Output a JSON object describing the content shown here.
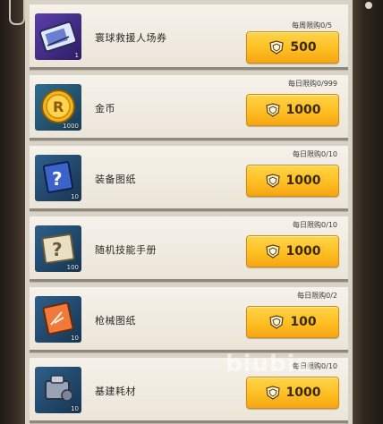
{
  "shop": {
    "items": [
      {
        "name": "寰球救援人场券",
        "limit": "每周限购0/5",
        "price": "500",
        "qty": "1",
        "icon": "ticket-icon"
      },
      {
        "name": "金币",
        "limit": "每日限购0/999",
        "price": "1000",
        "qty": "1000",
        "icon": "gold-coin-icon"
      },
      {
        "name": "装备图纸",
        "limit": "每日限购0/10",
        "price": "1000",
        "qty": "10",
        "icon": "equipment-blueprint-icon"
      },
      {
        "name": "随机技能手册",
        "limit": "每日限购0/10",
        "price": "1000",
        "qty": "100",
        "icon": "skill-manual-icon"
      },
      {
        "name": "枪械图纸",
        "limit": "每日限购0/2",
        "price": "100",
        "qty": "10",
        "icon": "firearm-blueprint-icon"
      },
      {
        "name": "基建耗材",
        "limit": "每日限购0/10",
        "price": "1000",
        "qty": "10",
        "icon": "construction-material-icon"
      }
    ]
  },
  "currency_icon": "badge-currency-icon",
  "watermark": "biubiu"
}
